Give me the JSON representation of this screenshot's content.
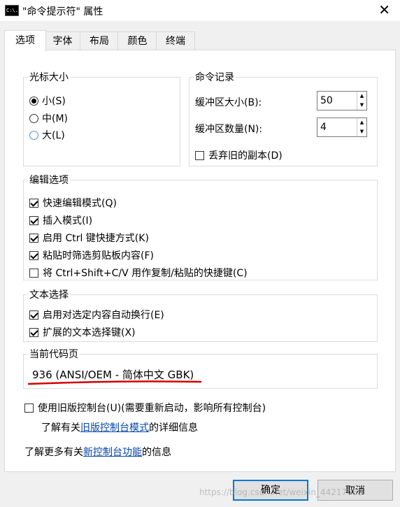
{
  "window": {
    "app_icon_text": "C:\\.",
    "title": "\"命令提示符\" 属性",
    "close_glyph": "✕"
  },
  "tabs": [
    {
      "label": "选项"
    },
    {
      "label": "字体"
    },
    {
      "label": "布局"
    },
    {
      "label": "颜色"
    },
    {
      "label": "终端"
    }
  ],
  "cursor_size": {
    "title": "光标大小",
    "options": [
      {
        "label": "小(S)",
        "checked": true
      },
      {
        "label": "中(M)",
        "checked": false
      },
      {
        "label": "大(L)",
        "checked": false
      }
    ]
  },
  "command_history": {
    "title": "命令记录",
    "buffer_size_label": "缓冲区大小(B):",
    "buffer_size_value": "50",
    "buffer_count_label": "缓冲区数量(N):",
    "buffer_count_value": "4",
    "discard_label": "丢弃旧的副本(D)",
    "discard_checked": false
  },
  "edit_options": {
    "title": "编辑选项",
    "items": [
      {
        "label": "快速编辑模式(Q)",
        "checked": true
      },
      {
        "label": "插入模式(I)",
        "checked": true
      },
      {
        "label": "启用 Ctrl 键快捷方式(K)",
        "checked": true
      },
      {
        "label": "粘贴时筛选剪贴板内容(F)",
        "checked": true
      },
      {
        "label": "将 Ctrl+Shift+C/V 用作复制/粘贴的快捷键(C)",
        "checked": false
      }
    ]
  },
  "text_selection": {
    "title": "文本选择",
    "items": [
      {
        "label": "启用对选定内容自动换行(E)",
        "checked": true
      },
      {
        "label": "扩展的文本选择键(X)",
        "checked": true
      }
    ]
  },
  "code_page": {
    "title": "当前代码页",
    "value": "936   (ANSI/OEM - 简体中文 GBK)",
    "annotation_color": "#d40000"
  },
  "legacy": {
    "label": "使用旧版控制台(U)(需要重新启动，影响所有控制台)",
    "checked": false,
    "info_prefix": "了解有关",
    "info_link": "旧版控制台模式",
    "info_suffix": "的详细信息"
  },
  "more_info": {
    "prefix": "了解更多有关",
    "link": "新控制台功能",
    "suffix": "的信息"
  },
  "buttons": {
    "ok": "确定",
    "cancel": "取消"
  },
  "watermark": "https://blog.csdn.net/weixin_44217485"
}
